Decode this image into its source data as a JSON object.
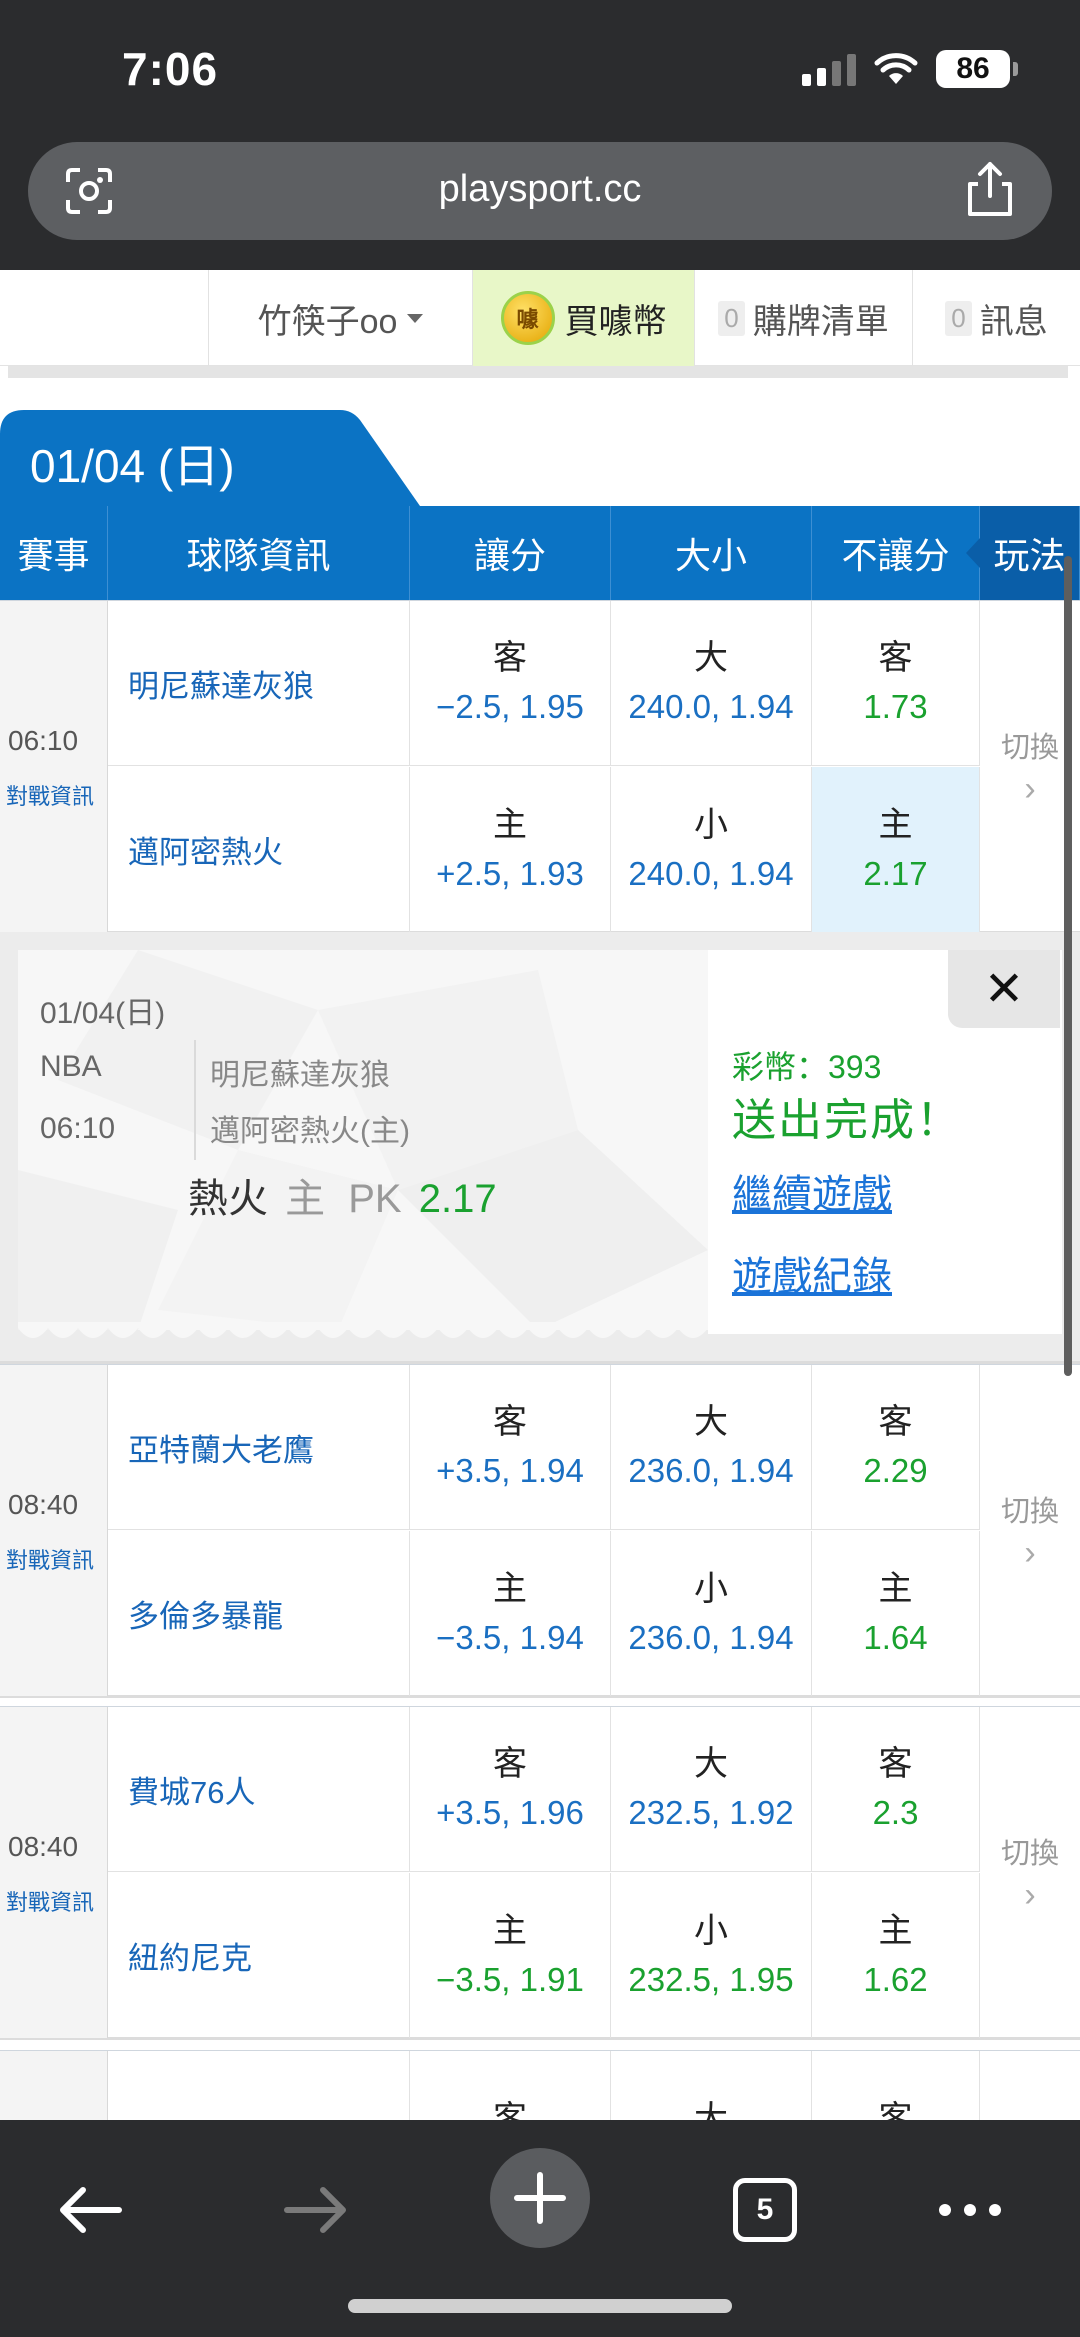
{
  "status": {
    "time": "7:06",
    "battery": "86"
  },
  "browser": {
    "url": "playsport.cc",
    "tab_count": "5"
  },
  "header": {
    "user": "竹筷子oo",
    "buy_coin": "買噱幣",
    "coin_glyph": "噱",
    "cart_count": "0",
    "cart_label": "購牌清單",
    "msg_count": "0",
    "msg_label": "訊息"
  },
  "date": "01/04 (日)",
  "columns": [
    "賽事",
    "球隊資訊",
    "讓分",
    "大小",
    "不讓分",
    "玩法"
  ],
  "match_info_label": "對戰資訊",
  "switch_label": "切換",
  "matches": [
    {
      "time": "06:10",
      "away": {
        "team": "明尼蘇達灰狼",
        "spread_label": "客",
        "spread": "−2.5, 1.95",
        "total_label": "大",
        "total": "240.0, 1.94",
        "ml_label": "客",
        "ml": "1.73"
      },
      "home": {
        "team": "邁阿密熱火",
        "spread_label": "主",
        "spread": "+2.5, 1.93",
        "total_label": "小",
        "total": "240.0, 1.94",
        "ml_label": "主",
        "ml": "2.17"
      }
    },
    {
      "time": "08:40",
      "away": {
        "team": "亞特蘭大老鷹",
        "spread_label": "客",
        "spread": "+3.5, 1.94",
        "total_label": "大",
        "total": "236.0, 1.94",
        "ml_label": "客",
        "ml": "2.29"
      },
      "home": {
        "team": "多倫多暴龍",
        "spread_label": "主",
        "spread": "−3.5, 1.94",
        "total_label": "小",
        "total": "236.0, 1.94",
        "ml_label": "主",
        "ml": "1.64"
      }
    },
    {
      "time": "08:40",
      "away": {
        "team": "費城76人",
        "spread_label": "客",
        "spread": "+3.5, 1.96",
        "total_label": "大",
        "total": "232.5, 1.92",
        "ml_label": "客",
        "ml": "2.3"
      },
      "home": {
        "team": "紐約尼克",
        "spread_label": "主",
        "spread": "−3.5, 1.91",
        "total_label": "小",
        "total": "232.5, 1.95",
        "ml_label": "主",
        "ml": "1.62"
      }
    }
  ],
  "partial_row": {
    "spread_label": "客",
    "total_label": "大",
    "ml_label": "客"
  },
  "popup": {
    "date": "01/04(日)",
    "league": "NBA",
    "time": "06:10",
    "away": "明尼蘇達灰狼",
    "home": "邁阿密熱火(主)",
    "pick_team": "熱火",
    "pick_side": "主",
    "pick_type": "PK",
    "pick_odds": "2.17",
    "coins": "彩幣：393",
    "done": "送出完成！",
    "continue": "繼續遊戲",
    "history": "遊戲紀錄",
    "close": "✕"
  }
}
